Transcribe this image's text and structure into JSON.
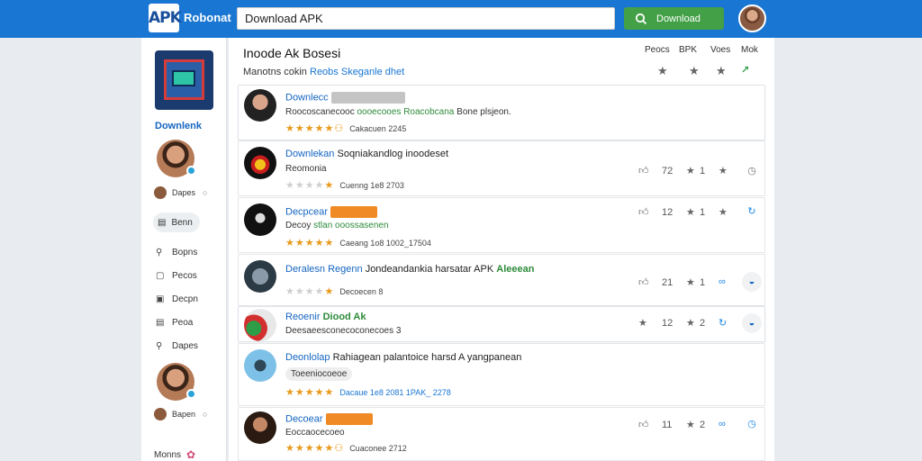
{
  "header": {
    "logo": "APK",
    "brand": "Robonat",
    "search_value": "Download APK",
    "download_button": "Download",
    "colors": {
      "bar": "#1976d2",
      "button": "#43a047"
    }
  },
  "sidebar": {
    "title": "Downlenk",
    "user1": "Dapes",
    "pill": "Benn",
    "nav": [
      "Bopns",
      "Pecos",
      "Decpn",
      "Peoa",
      "Dapes"
    ],
    "user2": "Bapen",
    "footer": "Monns"
  },
  "main": {
    "title": "Inoode Ak Bosesi",
    "subtitle_a": "Manotns cokin",
    "subtitle_b": "Reobs Skeganle dhet",
    "col_heads": [
      "Peocs",
      "BPK",
      "Voes",
      "Mok"
    ],
    "rows": [
      {
        "name": "Downlecc",
        "name_extra": "",
        "desc_a": "Roocoscanecooc",
        "desc_g": "oooecooes Roacobcana",
        "desc_b": "Bone plsjeon.",
        "stars_on": 5,
        "meta": "Cakacuen 2245",
        "v1": "",
        "v2": ""
      },
      {
        "name": "Downlekan",
        "name_extra": "Soqniakandlog inoodeset",
        "desc_a": "Reomonia",
        "desc_g": "",
        "desc_b": "",
        "stars_on": 0,
        "meta": "Cuenng 1e8 2703",
        "v1": "72",
        "v2": "1"
      },
      {
        "name": "Decpcear",
        "name_extra": "",
        "desc_a": "Decoy",
        "desc_g": "stlan ooossasenen",
        "desc_b": "",
        "stars_on": 5,
        "meta": "Caeang 1o8 1002_17504",
        "v1": "12",
        "v2": "1"
      },
      {
        "name": "Deralesn Regenn",
        "name_extra": "Jondeandankia harsatar APK",
        "desc_a": "",
        "desc_g": "Aleeean",
        "desc_b": "",
        "stars_on": 0,
        "meta": "Decoecen 8",
        "v1": "21",
        "v2": "1"
      },
      {
        "name": "Reoenir",
        "name_extra": "Diood Ak",
        "desc_a": "Deesaeesconecoconecoes 3",
        "desc_g": "",
        "desc_b": "",
        "stars_on": 0,
        "meta": "",
        "v1": "12",
        "v2": "2"
      },
      {
        "name": "Deonlolap",
        "name_extra": "Rahiagean palantoice harsd A yangpanean",
        "desc_a": "",
        "desc_g": "",
        "desc_b": "Toeeniocoeoe",
        "stars_on": 5,
        "meta": "Dacaue 1e8 2081 1PAK_ 2278",
        "v1": "",
        "v2": ""
      },
      {
        "name": "Decoear",
        "name_extra": "",
        "desc_a": "Eoccaocecoeo",
        "desc_g": "",
        "desc_b": "",
        "stars_on": 5,
        "meta": "Cuaconee 2712",
        "v1": "11",
        "v2": "2"
      }
    ]
  }
}
